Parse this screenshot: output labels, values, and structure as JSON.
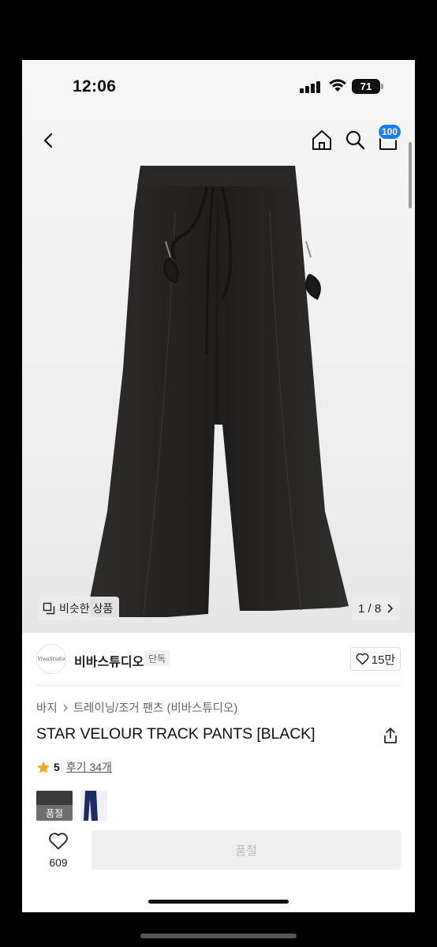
{
  "status_bar": {
    "time": "12:06",
    "battery": "71"
  },
  "nav": {
    "cart_badge": "100"
  },
  "gallery": {
    "similar_label": "비슷한 상품",
    "pager": "1 / 8"
  },
  "store": {
    "name": "비바스튜디오",
    "badge": "단독",
    "likes": "15만",
    "logo_text": "ViwaStudio"
  },
  "breadcrumb": {
    "level1": "바지",
    "level2": "트레이닝/조거 팬츠 (비바스튜디오)"
  },
  "product": {
    "name": "STAR VELOUR TRACK PANTS [BLACK]"
  },
  "rating": {
    "score": "5",
    "reviews": "후기 34개"
  },
  "options": {
    "soldout_label": "품절"
  },
  "bottom": {
    "wish_count": "609",
    "buy_label": "품절"
  },
  "colors": {
    "accent": "#1d7bf5",
    "star": "#f5a623",
    "product": "#2b2926"
  },
  "icons": [
    "back-icon",
    "home-icon",
    "search-icon",
    "cart-icon",
    "similar-icon",
    "chevron-right-icon",
    "heart-icon",
    "share-icon",
    "star-icon"
  ]
}
